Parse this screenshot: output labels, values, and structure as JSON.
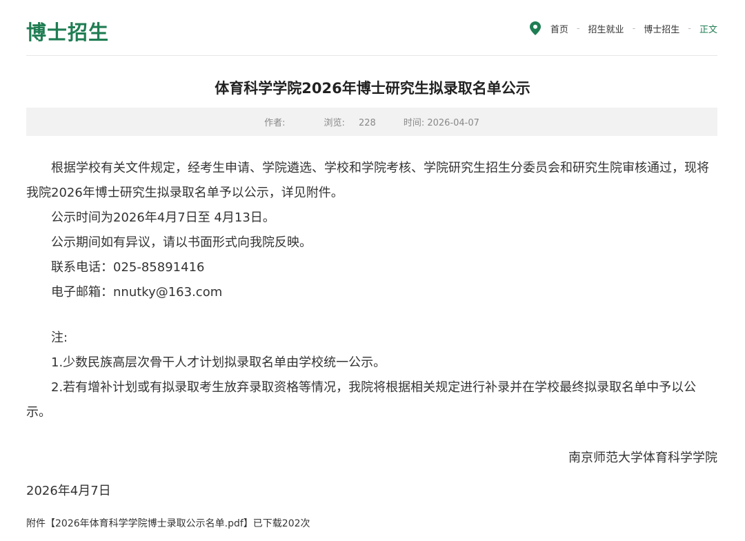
{
  "header": {
    "site_title": "博士招生",
    "breadcrumb": {
      "items": [
        "首页",
        "招生就业",
        "博士招生",
        "正文"
      ],
      "separator": "-"
    },
    "icon": "location-pin-icon",
    "accent_color": "#1f7d53"
  },
  "article": {
    "title": "体育科学学院2026年博士研究生拟录取名单公示",
    "meta": {
      "author_label": "作者:",
      "author_value": "",
      "views_label": "浏览:",
      "views_value": "228",
      "time_label": "时间:",
      "time_value": "2026-04-07"
    },
    "paragraphs": [
      "根据学校有关文件规定，经考生申请、学院遴选、学校和学院考核、学院研究生招生分委员会和研究生院审核通过，现将我院2026年博士研究生拟录取名单予以公示，详见附件。",
      "公示时间为2026年4月7日至 4月13日。",
      "公示期间如有异议，请以书面形式向我院反映。",
      "联系电话：025-85891416",
      "电子邮箱：nnutky@163.com"
    ],
    "notes": [
      "注:",
      "1.少数民族高层次骨干人才计划拟录取名单由学校统一公示。",
      "2.若有增补计划或有拟录取考生放弃录取资格等情况，我院将根据相关规定进行补录并在学校最终拟录取名单中予以公示。"
    ],
    "signature": "南京师范大学体育科学学院",
    "date": "2026年4月7日",
    "attachment": {
      "prefix": "附件",
      "link_text": "【2026年体育科学学院博士录取公示名单.pdf】",
      "downloads": "已下载202次"
    }
  }
}
